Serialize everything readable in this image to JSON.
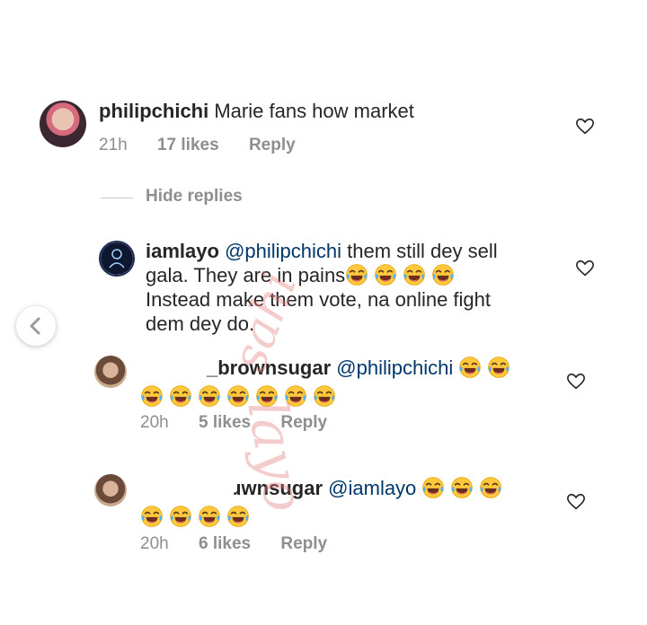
{
  "colors": {
    "mention": "#00376b",
    "meta": "#8e8e8e",
    "text": "#262626",
    "watermark": "#e27878"
  },
  "comment": {
    "username": "philipchichi",
    "text": "Marie fans how market",
    "time": "21h",
    "likes": "17 likes",
    "reply": "Reply"
  },
  "hide_replies": "Hide replies",
  "reply1": {
    "username": "iamlayo",
    "mention": "@philipchichi",
    "line1": "them still dey sell",
    "line2": "gala. They are in pains",
    "line3": "Instead make them vote, na online fight",
    "line4": "dem dey do."
  },
  "reply2": {
    "username": "_brownsugar",
    "mention": "@philipchichi",
    "time": "20h",
    "likes": "5 likes",
    "reply": "Reply"
  },
  "reply3": {
    "username": "ɹwnsugar",
    "mention": "@iamlayo",
    "time": "20h",
    "likes": "6 likes",
    "reply": "Reply"
  },
  "watermark": {
    "line1": "sahi",
    "line2": "layo"
  },
  "icons": [
    "heart-icon",
    "chevron-left-icon",
    "laughing-emoji"
  ]
}
